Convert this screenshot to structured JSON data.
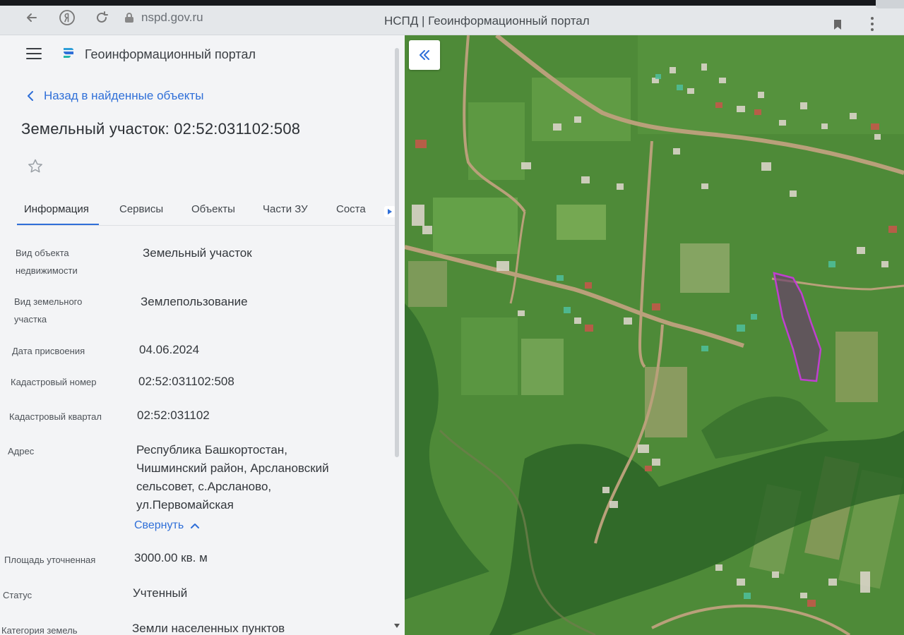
{
  "browser": {
    "url": "nspd.gov.ru",
    "page_title": "НСПД | Геоинформационный портал"
  },
  "header": {
    "portal_name": "Геоинформационный портал"
  },
  "back_link": "Назад в найденные объекты",
  "object_title": "Земельный участок: 02:52:031102:508",
  "tabs": [
    {
      "label": "Информация",
      "active": true
    },
    {
      "label": "Сервисы"
    },
    {
      "label": "Объекты"
    },
    {
      "label": "Части ЗУ"
    },
    {
      "label": "Соста"
    }
  ],
  "info": {
    "object_type_label_1": "Вид объекта",
    "object_type_label_2": "недвижимости",
    "object_type_value": "Земельный участок",
    "land_type_label_1": "Вид земельного",
    "land_type_label_2": "участка",
    "land_type_value": "Землепользование",
    "date_label": "Дата присвоения",
    "date_value": "04.06.2024",
    "cadastral_number_label": "Кадастровый номер",
    "cadastral_number_value": "02:52:031102:508",
    "cadastral_block_label": "Кадастровый квартал",
    "cadastral_block_value": "02:52:031102",
    "address_label": "Адрес",
    "address_line_1": "Республика Башкортостан,",
    "address_line_2": "Чишминский район, Арслановский",
    "address_line_3": "сельсовет, с.Арсланово,",
    "address_line_4": "ул.Первомайская",
    "collapse_label": "Свернуть",
    "area_label": "Площадь уточненная",
    "area_value": "3000.00 кв. м",
    "status_label": "Статус",
    "status_value": "Учтенный",
    "category_label": "Категория земель",
    "category_value": "Земли населенных пунктов"
  },
  "colors": {
    "accent": "#2f6fd8",
    "parcel_outline": "#c03fd0",
    "map_green": "#4f8a3a"
  }
}
